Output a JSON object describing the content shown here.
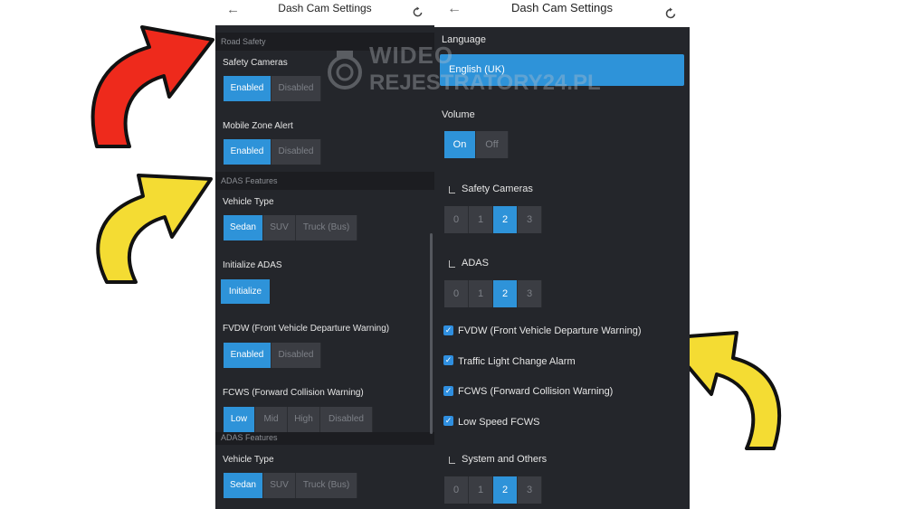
{
  "left": {
    "title": "Dash Cam Settings",
    "sections": {
      "road_safety": "Road Safety",
      "adas": "ADAS Features",
      "adas_repeat": "ADAS Features"
    },
    "safety_cameras": {
      "label": "Safety Cameras",
      "options": [
        "Enabled",
        "Disabled"
      ],
      "selected": "Enabled"
    },
    "mobile_zone": {
      "label": "Mobile Zone Alert",
      "options": [
        "Enabled",
        "Disabled"
      ],
      "selected": "Enabled"
    },
    "vehicle_type": {
      "label": "Vehicle Type",
      "options": [
        "Sedan",
        "SUV",
        "Truck (Bus)"
      ],
      "selected": "Sedan"
    },
    "initialize": {
      "label": "Initialize ADAS",
      "button": "Initialize"
    },
    "fvdw": {
      "label": "FVDW (Front Vehicle Departure Warning)",
      "options": [
        "Enabled",
        "Disabled"
      ],
      "selected": "Enabled"
    },
    "fcws": {
      "label": "FCWS (Forward Collision Warning)",
      "options": [
        "Low",
        "Mid",
        "High",
        "Disabled"
      ],
      "selected": "Low"
    },
    "vehicle_type_2": {
      "label": "Vehicle Type",
      "options": [
        "Sedan",
        "SUV",
        "Truck (Bus)"
      ],
      "selected": "Sedan"
    }
  },
  "right": {
    "title": "Dash Cam Settings",
    "language": {
      "label": "Language",
      "value": "English (UK)"
    },
    "volume": {
      "label": "Volume",
      "options": [
        "On",
        "Off"
      ],
      "selected": "On"
    },
    "safety_cameras": {
      "label": "Safety Cameras",
      "options": [
        "0",
        "1",
        "2",
        "3"
      ],
      "selected": "2"
    },
    "adas": {
      "label": "ADAS",
      "options": [
        "0",
        "1",
        "2",
        "3"
      ],
      "selected": "2"
    },
    "checks": [
      {
        "label": "FVDW (Front Vehicle Departure Warning)",
        "checked": true
      },
      {
        "label": "Traffic Light Change Alarm",
        "checked": true
      },
      {
        "label": "FCWS (Forward Collision Warning)",
        "checked": true
      },
      {
        "label": "Low Speed FCWS",
        "checked": true
      }
    ],
    "system": {
      "label": "System and Others",
      "options": [
        "0",
        "1",
        "2",
        "3"
      ],
      "selected": "2"
    }
  },
  "watermark": {
    "line1": "WIDEO",
    "line2": "REJESTRATORY24.PL"
  },
  "colors": {
    "accent": "#2e93d9",
    "panel": "#24262b",
    "arrow_red": "#ee2a1c",
    "arrow_yellow": "#f4dc33"
  },
  "icons": {
    "back": "arrow-left-icon",
    "reset": "refresh-icon",
    "arrows": "curved-arrow-icon"
  }
}
